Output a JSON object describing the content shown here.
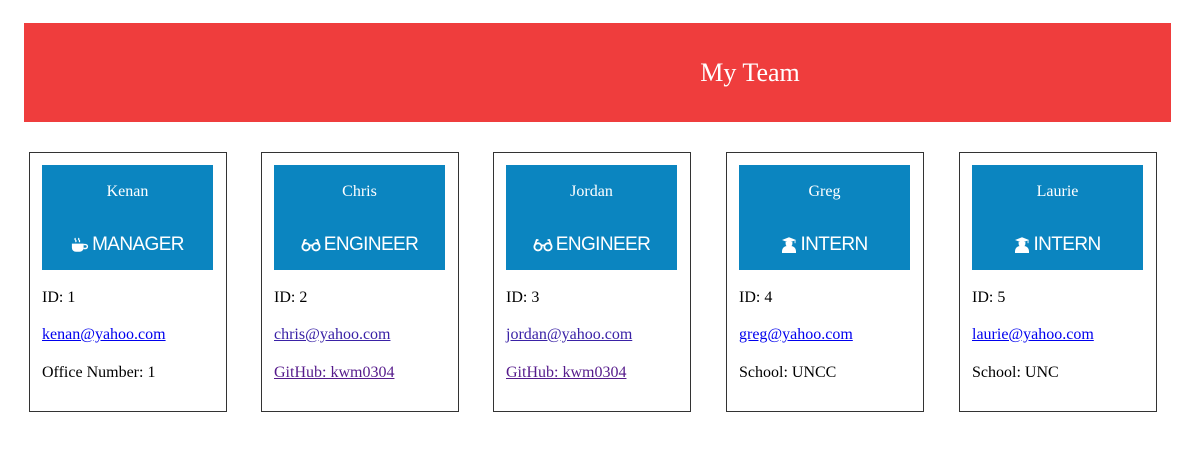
{
  "colors": {
    "header_bg": "#ef3d3d",
    "card_header_bg": "#0b85c0",
    "link": "#0000ee",
    "visited_link": "#551a8b"
  },
  "header": {
    "title": "My Team"
  },
  "team": {
    "members": [
      {
        "name": "Kenan",
        "role": "MANAGER",
        "icon": "coffee-icon",
        "id_label": "ID: 1",
        "email": "kenan@yahoo.com",
        "extra": "Office Number: 1"
      },
      {
        "name": "Chris",
        "role": "ENGINEER",
        "icon": "glasses-icon",
        "id_label": "ID: 2",
        "email": "chris@yahoo.com",
        "extra": "GitHub: kwm0304"
      },
      {
        "name": "Jordan",
        "role": "ENGINEER",
        "icon": "glasses-icon",
        "id_label": "ID: 3",
        "email": "jordan@yahoo.com",
        "extra": "GitHub: kwm0304"
      },
      {
        "name": "Greg",
        "role": "INTERN",
        "icon": "user-graduate-icon",
        "id_label": "ID: 4",
        "email": "greg@yahoo.com",
        "extra": "School: UNCC"
      },
      {
        "name": "Laurie",
        "role": "INTERN",
        "icon": "user-graduate-icon",
        "id_label": "ID: 5",
        "email": "laurie@yahoo.com",
        "extra": "School: UNC"
      }
    ]
  }
}
